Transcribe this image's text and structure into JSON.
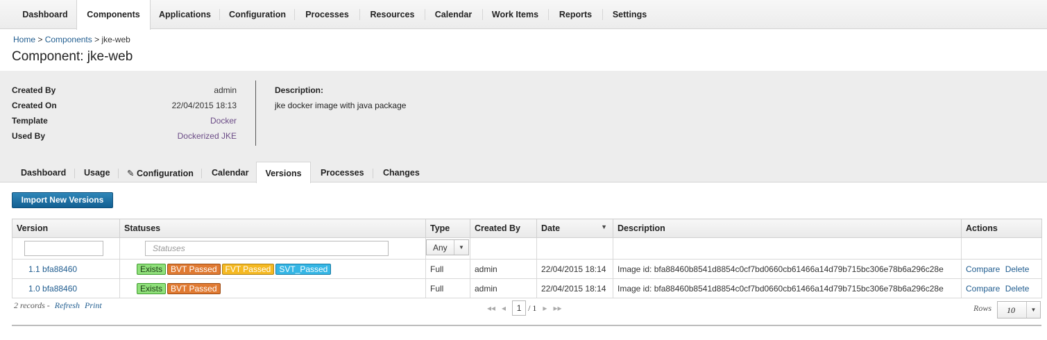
{
  "topnav": {
    "tabs": [
      "Dashboard",
      "Components",
      "Applications",
      "Configuration",
      "Processes",
      "Resources",
      "Calendar",
      "Work Items",
      "Reports",
      "Settings"
    ],
    "active": "Components"
  },
  "breadcrumb": {
    "home": "Home",
    "sep1": ">",
    "components": "Components",
    "sep2": ">",
    "current": "jke-web"
  },
  "page_title": "Component: jke-web",
  "info": {
    "created_by_label": "Created By",
    "created_by": "admin",
    "created_on_label": "Created On",
    "created_on": "22/04/2015 18:13",
    "template_label": "Template",
    "template": "Docker",
    "used_by_label": "Used By",
    "used_by": "Dockerized JKE",
    "description_label": "Description:",
    "description": "jke docker image with java package"
  },
  "subtabs": {
    "dashboard": "Dashboard",
    "usage": "Usage",
    "configuration": "Configuration",
    "calendar": "Calendar",
    "versions": "Versions",
    "processes": "Processes",
    "changes": "Changes",
    "active": "Versions"
  },
  "import_button": "Import New Versions",
  "table": {
    "headers": {
      "version": "Version",
      "statuses": "Statuses",
      "type": "Type",
      "created_by": "Created By",
      "date": "Date",
      "description": "Description",
      "actions": "Actions"
    },
    "filters": {
      "statuses_placeholder": "Statuses",
      "type_value": "Any"
    },
    "rows": [
      {
        "version": "1.1 bfa88460",
        "statuses": [
          "Exists",
          "BVT Passed",
          "FVT Passed",
          "SVT_Passed"
        ],
        "type": "Full",
        "created_by": "admin",
        "date": "22/04/2015 18:14",
        "description": "Image id: bfa88460b8541d8854c0cf7bd0660cb61466a14d79b715bc306e78b6a296c28e",
        "compare": "Compare",
        "delete": "Delete"
      },
      {
        "version": "1.0 bfa88460",
        "statuses": [
          "Exists",
          "BVT Passed"
        ],
        "type": "Full",
        "created_by": "admin",
        "date": "22/04/2015 18:14",
        "description": "Image id: bfa88460b8541d8854c0cf7bd0660cb61466a14d79b715bc306e78b6a296c28e",
        "compare": "Compare",
        "delete": "Delete"
      }
    ]
  },
  "footer": {
    "records": "2 records",
    "dash": "-",
    "refresh": "Refresh",
    "print": "Print",
    "page": "1",
    "of_pages": "/ 1",
    "rows_label": "Rows",
    "rows_value": "10"
  },
  "status_colors": {
    "Exists": "#8fe07a",
    "BVT Passed": "#e07a32",
    "FVT Passed": "#f5b922",
    "SVT_Passed": "#35b6e5"
  }
}
